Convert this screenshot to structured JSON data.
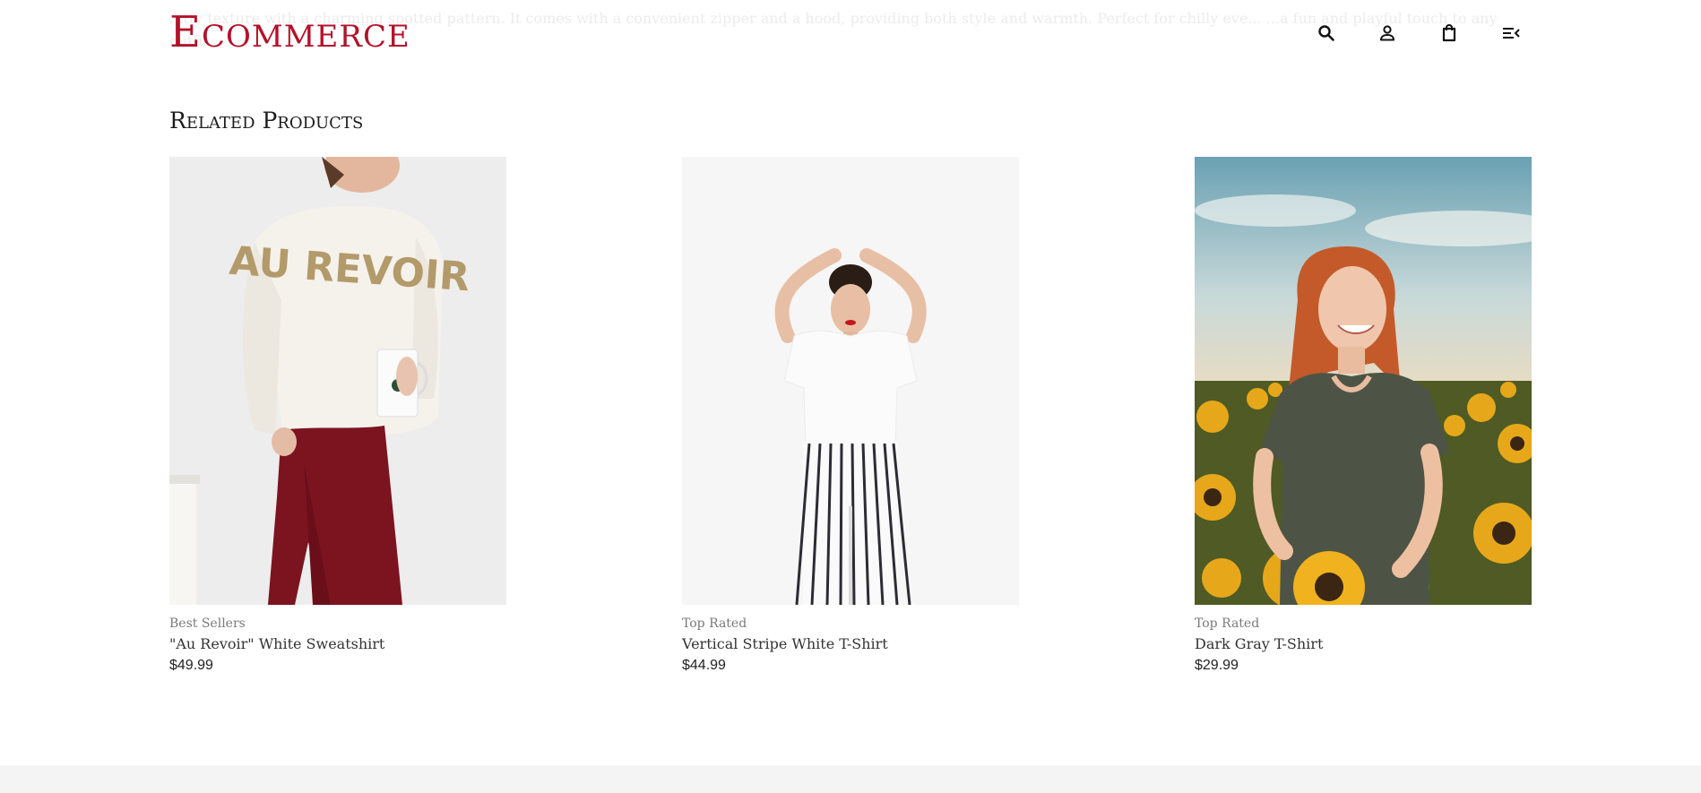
{
  "background_description": "...tty texture with a charming spotted pattern. It comes with a convenient zipper and a hood, providing both style and warmth. Perfect for chilly eve... ...a fun and playful touch to any outfit.",
  "header": {
    "logo": "Ecommerce",
    "icons": [
      "search-icon",
      "account-icon",
      "bag-icon",
      "menu-icon"
    ]
  },
  "related": {
    "title": "Related Products",
    "products": [
      {
        "category": "Best Sellers",
        "name": "\"Au Revoir\" White Sweatshirt",
        "price": "$49.99"
      },
      {
        "category": "Top Rated",
        "name": "Vertical Stripe White T-Shirt",
        "price": "$44.99"
      },
      {
        "category": "Top Rated",
        "name": "Dark Gray T-Shirt",
        "price": "$29.99"
      }
    ]
  },
  "product_image_text": {
    "sweatshirt_print": "AU REVOIR"
  },
  "colors": {
    "brand": "#b3122a",
    "footer": "#f4f4f4"
  }
}
